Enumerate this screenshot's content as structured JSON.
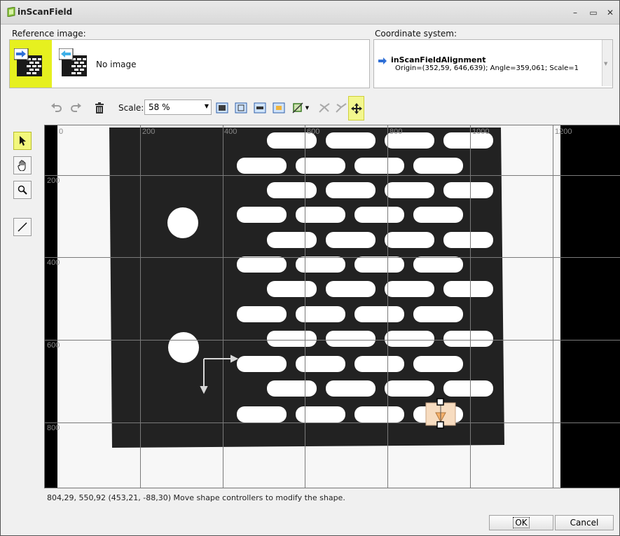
{
  "window": {
    "title": "inScanField"
  },
  "reference": {
    "label": "Reference image:",
    "no_image": "No image"
  },
  "coordinate": {
    "label": "Coordinate system:",
    "name": "inScanFieldAlignment",
    "details": "Origin=(352,59, 646,639); Angle=359,061; Scale=1"
  },
  "toolbar": {
    "scale_label": "Scale:",
    "scale_value": "58 %"
  },
  "ruler": {
    "x": [
      "0",
      "200",
      "400",
      "600",
      "800",
      "1000",
      "1200"
    ],
    "y": [
      "200",
      "400",
      "600",
      "800"
    ]
  },
  "status": {
    "text": "804,29, 550,92 (453,21, -88,30)  Move shape controllers to modify the shape."
  },
  "buttons": {
    "ok": "OK",
    "cancel": "Cancel"
  },
  "colors": {
    "highlight": "#f2f77c",
    "accent_blue": "#2f6fd6",
    "canvas_bg": "#000000",
    "paper": "#f8f8f8",
    "plate": "#242424"
  },
  "icons": [
    "app-icon",
    "undo-icon",
    "redo-icon",
    "delete-icon",
    "zoom-fit-icon",
    "zoom-region-icon",
    "zoom-horizontal-icon",
    "zoom-image-icon",
    "crop-icon",
    "snap-off-icon",
    "snap-icon",
    "move-icon",
    "select-arrow-icon",
    "hand-icon",
    "magnifier-icon",
    "line-tool-icon"
  ]
}
